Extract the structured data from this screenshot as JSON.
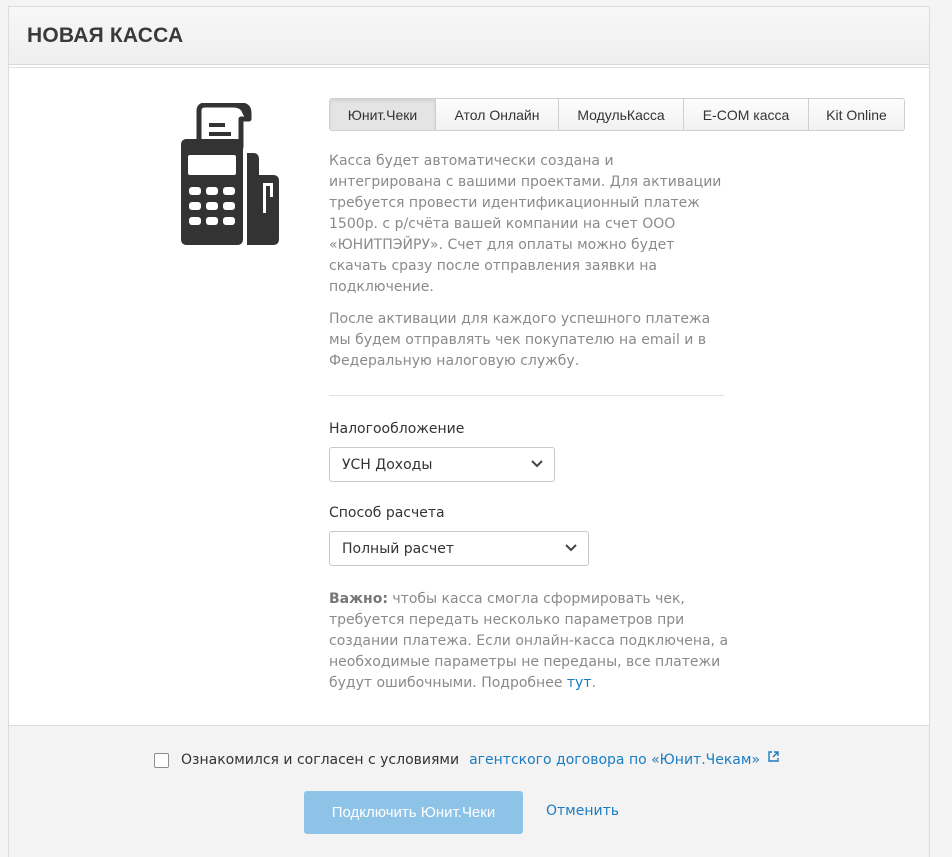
{
  "header": {
    "title": "НОВАЯ КАССА"
  },
  "tabs": [
    {
      "label": "Юнит.Чеки",
      "active": true
    },
    {
      "label": "Атол Онлайн",
      "active": false
    },
    {
      "label": "МодульКасса",
      "active": false
    },
    {
      "label": "E-COM касса",
      "active": false
    },
    {
      "label": "Kit Online",
      "active": false
    }
  ],
  "description": {
    "p1": "Касса будет автоматически создана и интегрирована с вашими проектами. Для активации требуется провести идентификационный платеж 1500р. с р/счёта вашей компании на счет ООО «ЮНИТПЭЙРУ». Счет для оплаты можно будет скачать сразу после отправления заявки на подключение.",
    "p2": "После активации для каждого успешного платежа мы будем отправлять чек покупателю на email и в Федеральную налоговую службу."
  },
  "taxation": {
    "label": "Налогообложение",
    "value": "УСН Доходы"
  },
  "payment_method": {
    "label": "Способ расчета",
    "value": "Полный расчет"
  },
  "note": {
    "bold": "Важно:",
    "text": " чтобы касса смогла сформировать чек, требуется передать несколько параметров при создании платежа. Если онлайн-касса подключена, а необходимые параметры не переданы, все платежи будут ошибочными. Подробнее ",
    "link": "тут",
    "end": "."
  },
  "footer": {
    "agree_text": "Ознакомился и согласен с условиями",
    "agree_link": "агентского договора по «Юнит.Чекам»",
    "agree_checked": false,
    "connect_label": "Подключить Юнит.Чеки",
    "cancel_label": "Отменить"
  },
  "colors": {
    "link": "#1a7dc2",
    "primary_button_disabled": "#8ec3e8",
    "icon": "#333333"
  },
  "icons": [
    "cash-register-icon",
    "chevron-down-icon",
    "external-link-icon",
    "checkbox"
  ]
}
